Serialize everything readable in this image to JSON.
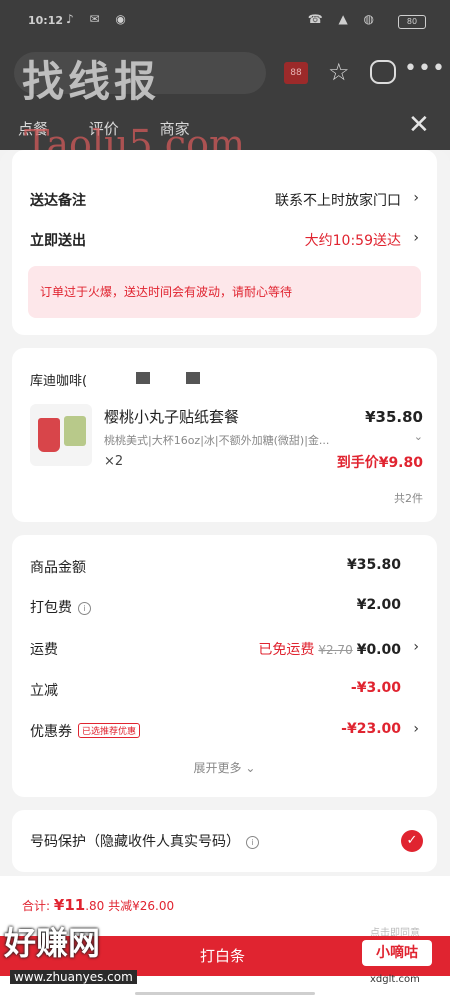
{
  "status_bar": {
    "time": "10:12",
    "battery": "80"
  },
  "background": {
    "tabs": [
      "点餐",
      "评价",
      "商家"
    ],
    "badge": "88"
  },
  "watermarks": {
    "top": "找线报",
    "mid": "Taolu5.com",
    "bottom_left": "好赚网",
    "bottom_left_url": "www.zhuanyes.com",
    "bottom_right": "小嘀咕",
    "bottom_right_url": "xdglt.com"
  },
  "delivery": {
    "note_label": "送达备注",
    "note_value": "联系不上时放家门口",
    "time_label": "立即送出",
    "time_value": "大约10:59送达",
    "notice": "订单过于火爆，送达时间会有波动，请耐心等待"
  },
  "order": {
    "shop_name": "库迪咖啡(",
    "product_name": "樱桃小丸子贴纸套餐",
    "price": "¥35.80",
    "spec": "桃桃美式|大杯16oz|冰|不额外加糖(微甜)|金...",
    "qty": "×2",
    "final_price": "到手价¥9.80",
    "count": "共2件"
  },
  "fees": {
    "goods_label": "商品金额",
    "goods_value": "¥35.80",
    "pack_label": "打包费",
    "pack_value": "¥2.00",
    "ship_label": "运费",
    "ship_free": "已免运费",
    "ship_orig": "¥2.70",
    "ship_value": "¥0.00",
    "reduce_label": "立减",
    "reduce_value": "-¥3.00",
    "coupon_label": "优惠券",
    "coupon_tag": "已选推荐优惠",
    "coupon_value": "-¥23.00",
    "expand": "展开更多"
  },
  "privacy": {
    "label": "号码保护（隐藏收件人真实号码）"
  },
  "footer": {
    "total_label": "合计:",
    "total_symbol": "¥",
    "total_int": "11",
    "total_dec": ".80",
    "saved": "共减¥26.00",
    "agreement": "点击即同意",
    "pay_label": "打白条"
  },
  "colors": {
    "accent": "#e02430",
    "notice_bg": "#fde7ea"
  }
}
